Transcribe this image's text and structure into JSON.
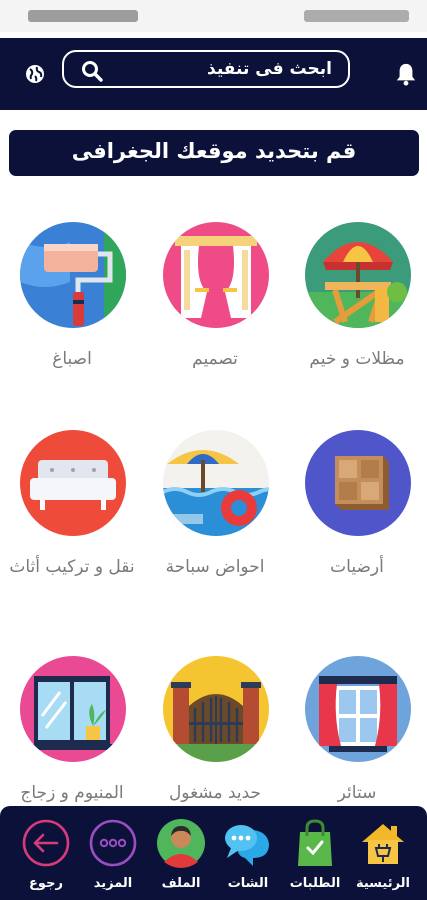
{
  "header": {
    "search_placeholder": "ابحث فى تنفيذ",
    "bell_icon": "bell-icon",
    "globe_icon": "globe-icon"
  },
  "location_banner": {
    "label": "قم بتحديد موقعك الجغرافى"
  },
  "categories": [
    {
      "label": "مظلات و خيم",
      "icon": "umbrella-table-icon"
    },
    {
      "label": "تصميم",
      "icon": "curtain-design-icon"
    },
    {
      "label": "اصباغ",
      "icon": "paint-roller-icon"
    },
    {
      "label": "أرضيات",
      "icon": "flooring-tile-icon"
    },
    {
      "label": "احواض سباحة",
      "icon": "swimming-pool-icon"
    },
    {
      "label": "نقل و تركيب أثاث",
      "icon": "sofa-icon"
    },
    {
      "label": "ستائر",
      "icon": "window-curtains-icon"
    },
    {
      "label": "حديد مشغول",
      "icon": "iron-gate-icon"
    },
    {
      "label": "المنيوم و زجاج",
      "icon": "aluminum-window-icon"
    }
  ],
  "bottom_nav": [
    {
      "label": "الرئيسية",
      "icon": "home-icon"
    },
    {
      "label": "الطلبات",
      "icon": "shopping-bag-icon"
    },
    {
      "label": "الشات",
      "icon": "chat-icon"
    },
    {
      "label": "الملف",
      "icon": "profile-avatar-icon"
    },
    {
      "label": "المزيد",
      "icon": "more-icon"
    },
    {
      "label": "رجوع",
      "icon": "back-arrow-icon"
    }
  ],
  "colors": {
    "navy": "#0b1138",
    "label_gray": "#7a7a7a"
  }
}
